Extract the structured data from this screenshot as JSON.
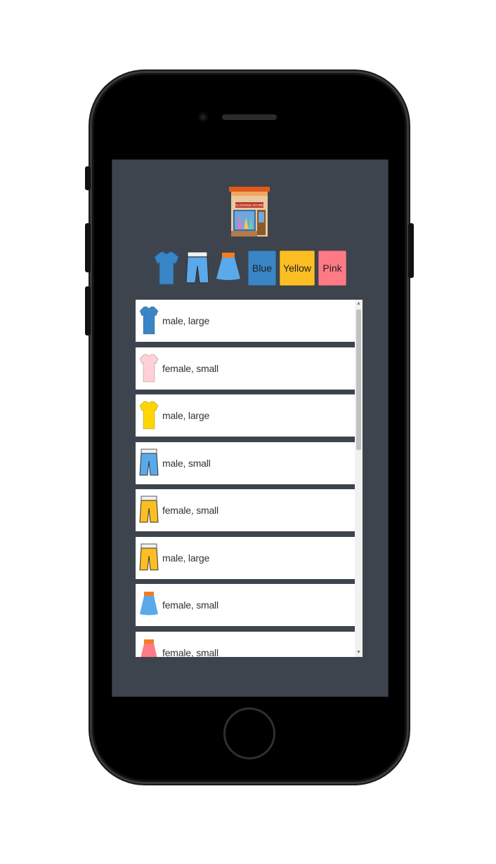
{
  "app": {
    "logo_icon": "clothing-store-icon",
    "logo_sign_text": "CLOTHING STORE"
  },
  "filters": {
    "icons": [
      {
        "name": "tshirt-filter",
        "icon": "tshirt-icon",
        "color": "#3a85c6"
      },
      {
        "name": "shorts-filter",
        "icon": "shorts-icon",
        "color": "#5aa9ea"
      },
      {
        "name": "skirt-filter",
        "icon": "skirt-icon",
        "color": "#5aa9ea"
      }
    ],
    "colors": [
      {
        "label": "Blue",
        "color": "#3a85c6"
      },
      {
        "label": "Yellow",
        "color": "#fbbf24"
      },
      {
        "label": "Pink",
        "color": "#fe7a86"
      }
    ]
  },
  "items": [
    {
      "label": "male, large",
      "icon": "tshirt-icon",
      "color": "#3a85c6"
    },
    {
      "label": "female, small",
      "icon": "tshirt-icon",
      "color": "#ffd0d6"
    },
    {
      "label": "male, large",
      "icon": "tshirt-icon",
      "color": "#ffd500"
    },
    {
      "label": "male, small",
      "icon": "shorts-icon",
      "color": "#5aa9ea"
    },
    {
      "label": "female, small",
      "icon": "shorts-icon",
      "color": "#fbbf24"
    },
    {
      "label": "male, large",
      "icon": "shorts-icon",
      "color": "#fbbf24"
    },
    {
      "label": "female, small",
      "icon": "skirt-icon",
      "color": "#5aa9ea"
    },
    {
      "label": "female, small",
      "icon": "skirt-icon",
      "color": "#fe7a86"
    }
  ],
  "scrollbar": {
    "scroll_position": 0
  }
}
